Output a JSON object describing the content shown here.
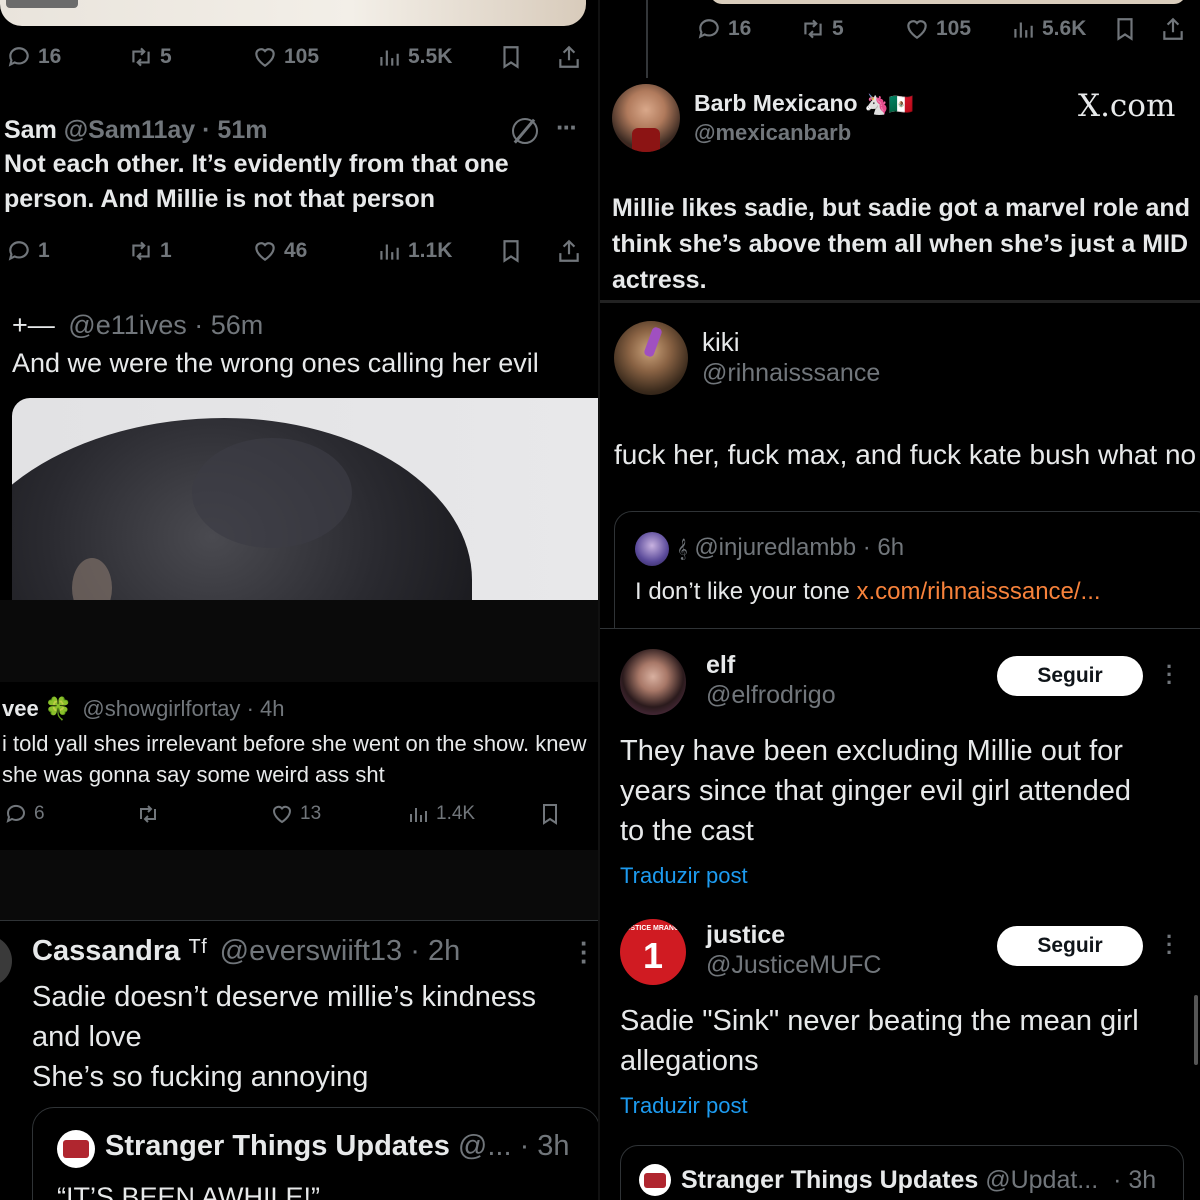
{
  "tl": {
    "top_actions": {
      "replies": "16",
      "retweets": "5",
      "likes": "105",
      "views": "5.5K"
    },
    "sam": {
      "name": "Sam",
      "handle": "@Sam11ay",
      "time": "· 51m",
      "text": "Not each other. It’s evidently from that one person. And Millie is not that person",
      "actions": {
        "replies": "1",
        "retweets": "1",
        "likes": "46",
        "views": "1.1K"
      }
    },
    "e11": {
      "name": "+—",
      "handle": "@e11ives",
      "time": "· 56m",
      "text": "And we were the wrong ones calling her evil"
    }
  },
  "tr": {
    "top_actions": {
      "replies": "16",
      "retweets": "5",
      "likes": "105",
      "views": "5.6K"
    },
    "barb": {
      "name": "Barb Mexicano",
      "emoji": "🦄🇲🇽",
      "handle": "@mexicanbarb",
      "watermark": "X.com",
      "text": "Millie likes sadie, but sadie got a marvel role and think she’s above them all when she’s just a MID actress."
    },
    "kiki": {
      "name": "kiki",
      "handle": "@rihnaisssance",
      "text": "fuck her, fuck max, and fuck kate bush what no",
      "quote": {
        "prefix": "𝄞",
        "handle": "@injuredlambb",
        "time": "· 6h",
        "text": "I don’t like your tone ",
        "link": "x.com/rihnaisssance/..."
      }
    }
  },
  "ml": {
    "vee": {
      "name": "vee",
      "emoji": "🍀",
      "handle": "@showgirlfortay",
      "time": "· 4h",
      "text": "i told yall shes irrelevant before she went on the show. knew she was gonna say some weird ass sht",
      "actions": {
        "replies": "6",
        "likes": "13",
        "views": "1.4K"
      }
    }
  },
  "bl": {
    "cassandra": {
      "name": "Cassandra",
      "glyph": "ᵀᶠ",
      "handle": "@everswiift13",
      "time": "· 2h",
      "text_lines": [
        "Sadie doesn’t deserve millie’s kindness",
        "and love",
        "She’s so fucking annoying"
      ],
      "quote": {
        "name": "Stranger Things Updates",
        "handle": "@...",
        "time": "· 3h",
        "text": "“IT’S BEEN AWHILE!”"
      }
    }
  },
  "br": {
    "elf": {
      "name": "elf",
      "handle": "@elfrodrigo",
      "follow": "Seguir",
      "text_lines": [
        "They have been excluding Millie out for",
        "years since that ginger evil girl attended",
        "to the cast"
      ],
      "translate": "Traduzir post"
    },
    "justice": {
      "name": "justice",
      "handle": "@JusticeMUFC",
      "follow": "Seguir",
      "avatar_number": "1",
      "avatar_text": "JUSTICE MRANCO",
      "text_lines": [
        "Sadie \"Sink\" never beating the mean girl",
        "allegations"
      ],
      "translate": "Traduzir post",
      "quote": {
        "name": "Stranger Things Updates",
        "handle": "@Updat...",
        "time": "· 3h"
      }
    }
  },
  "colors": {
    "bg": "#000000",
    "text": "#e7e9ea",
    "muted": "#71767b",
    "link": "#1d9bf0",
    "link_orange": "#f7823b"
  }
}
